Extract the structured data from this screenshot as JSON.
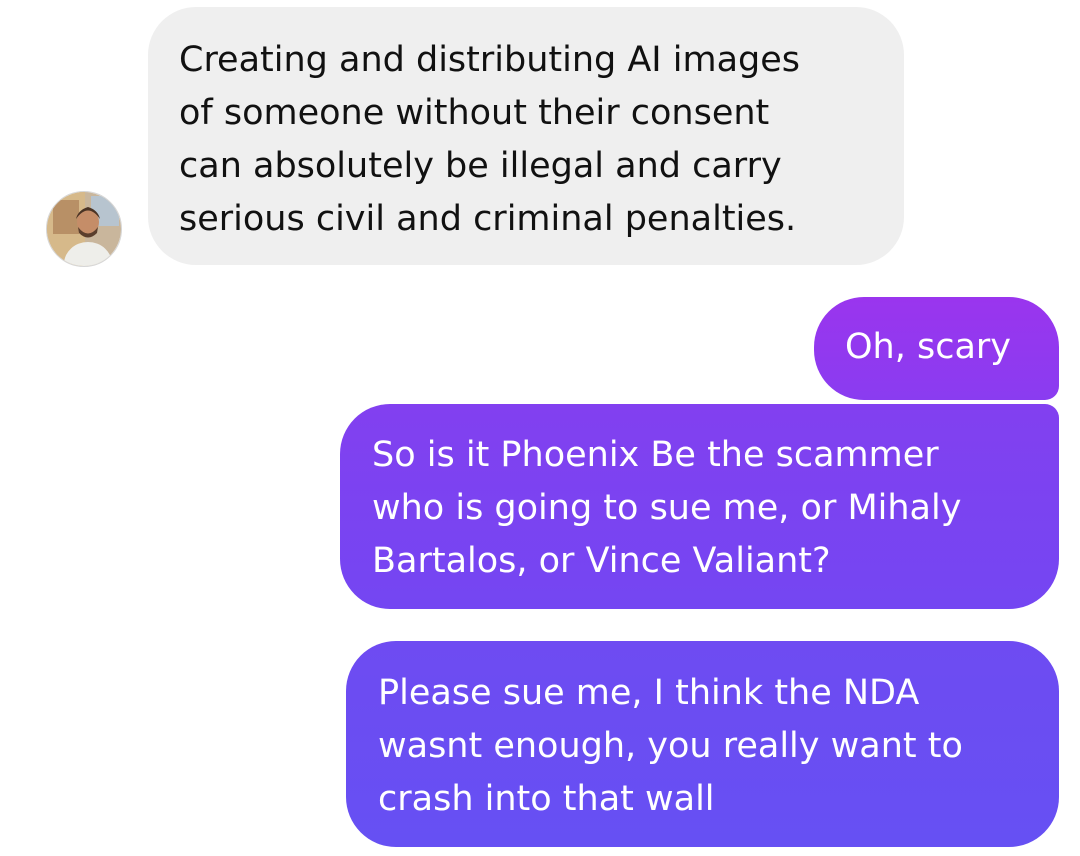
{
  "conversation": {
    "messages": [
      {
        "sender": "contact",
        "text": "Creating and distributing AI images\nof someone without their consent\ncan absolutely be illegal and carry\nserious civil and criminal penalties."
      },
      {
        "sender": "me",
        "text": "Oh, scary"
      },
      {
        "sender": "me",
        "text": "So is it Phoenix Be the scammer\nwho is going to sue me, or Mihaly\nBartalos, or Vince Valiant?"
      },
      {
        "sender": "me",
        "text": "Please sue me, I think the NDA\nwasnt enough, you really want to\ncrash into that wall"
      }
    ]
  },
  "contact": {
    "avatar_icon": "profile-photo-avatar"
  },
  "colors": {
    "incoming_bubble": "#efefef",
    "outgoing_bubble_top": "#9a35ee",
    "outgoing_bubble_bottom": "#6650f3"
  }
}
